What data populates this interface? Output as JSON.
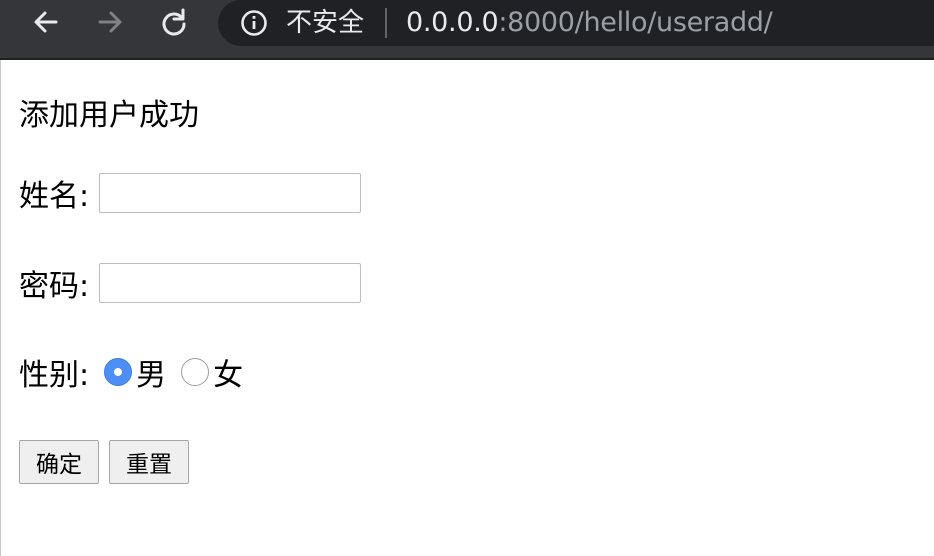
{
  "browser": {
    "security_label": "不安全",
    "url_host": "0.0.0.0",
    "url_rest": ":8000/hello/useradd/",
    "icons": {
      "back": "arrow-left-icon",
      "forward": "arrow-right-icon",
      "reload": "reload-icon",
      "info": "info-circle-icon"
    }
  },
  "page": {
    "message": "添加用户成功",
    "form": {
      "name_label": "姓名:",
      "name_value": "",
      "password_label": "密码:",
      "password_value": "",
      "gender_label": "性别:",
      "gender_options": [
        {
          "label": "男",
          "checked": true
        },
        {
          "label": "女",
          "checked": false
        }
      ],
      "submit_label": "确定",
      "reset_label": "重置"
    }
  },
  "colors": {
    "toolbar": "#35363a",
    "omnibox": "#202124",
    "radio_accent": "#4d8ff4"
  }
}
